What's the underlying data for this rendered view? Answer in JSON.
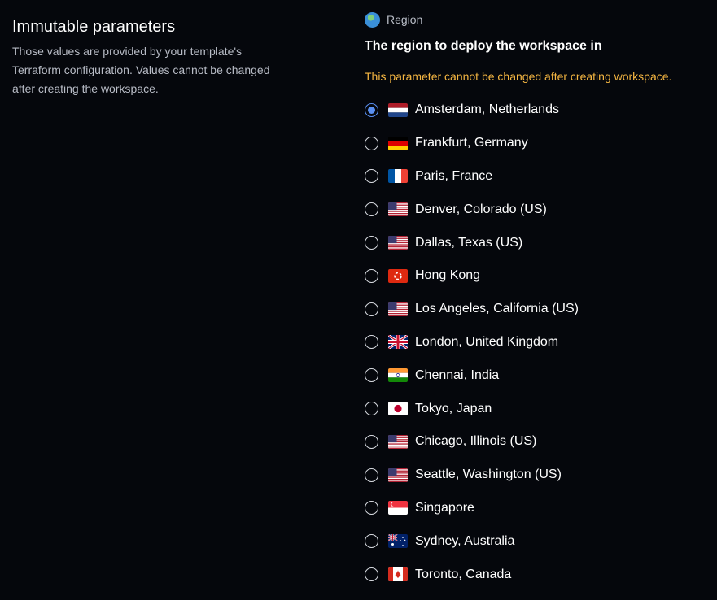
{
  "section": {
    "title": "Immutable parameters",
    "description": "Those values are provided by your template's Terraform configuration. Values cannot be changed after creating the workspace."
  },
  "parameter": {
    "icon": "globe-icon",
    "name": "Region",
    "title": "The region to deploy the workspace in",
    "warning": "This parameter cannot be changed after creating workspace.",
    "selected": "Amsterdam, Netherlands",
    "accent_color": "#5a8ff0",
    "warning_color": "#f5b642",
    "options": [
      {
        "label": "Amsterdam, Netherlands",
        "flag": "nl-flag-icon"
      },
      {
        "label": "Frankfurt, Germany",
        "flag": "de-flag-icon"
      },
      {
        "label": "Paris, France",
        "flag": "fr-flag-icon"
      },
      {
        "label": "Denver, Colorado (US)",
        "flag": "us-flag-icon"
      },
      {
        "label": "Dallas, Texas (US)",
        "flag": "us-flag-icon"
      },
      {
        "label": "Hong Kong",
        "flag": "hk-flag-icon"
      },
      {
        "label": "Los Angeles, California (US)",
        "flag": "us-flag-icon"
      },
      {
        "label": "London, United Kingdom",
        "flag": "gb-flag-icon"
      },
      {
        "label": "Chennai, India",
        "flag": "in-flag-icon"
      },
      {
        "label": "Tokyo, Japan",
        "flag": "jp-flag-icon"
      },
      {
        "label": "Chicago, Illinois (US)",
        "flag": "us-flag-icon"
      },
      {
        "label": "Seattle, Washington (US)",
        "flag": "us-flag-icon"
      },
      {
        "label": "Singapore",
        "flag": "sg-flag-icon"
      },
      {
        "label": "Sydney, Australia",
        "flag": "au-flag-icon"
      },
      {
        "label": "Toronto, Canada",
        "flag": "ca-flag-icon"
      }
    ]
  }
}
